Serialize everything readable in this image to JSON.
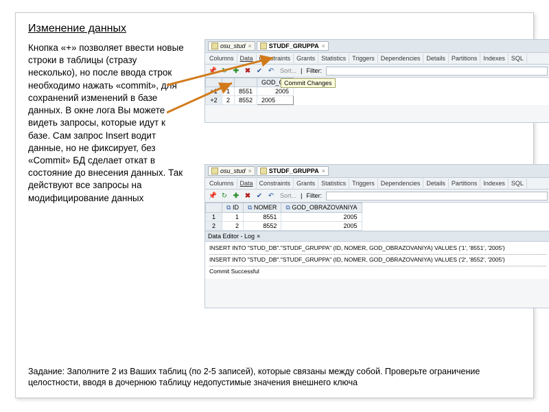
{
  "title": "Изменение данных",
  "body": "Кнопка «+» позволяет ввести новые строки в таблицы (стразу несколько), но после ввода строк необходимо нажать «commit», для сохранений изменений в базе данных. В окне лога Вы можете видеть запросы, которые идут к базе. Сам запрос Insert водит данные, но не фиксирует, без «Commit» БД сделает откат в состояние до  внесения данных. Так действуют все запросы на модифицирование данных",
  "task": "Задание: Заполните 2 из Ваших таблиц (по 2-5 записей), которые связаны между собой. Проверьте ограничение целостности, вводя в дочернюю таблицу недопустимые значения  внешнего ключа",
  "top_panel": {
    "file_tabs": [
      "osu_stud",
      "STUDF_GRUPPA"
    ],
    "sub_tabs": [
      "Columns",
      "Data",
      "Constraints",
      "Grants",
      "Statistics",
      "Triggers",
      "Dependencies",
      "Details",
      "Partitions",
      "Indexes",
      "SQL"
    ],
    "active_sub": "Data",
    "toolbar": {
      "sort": "Sort...",
      "filter": "Filter:"
    },
    "tooltip": "Commit Changes",
    "col_header_trunc": "GOD_O...",
    "rows": [
      {
        "n": "+1",
        "id": "1",
        "nomer": "8551",
        "god": "2005"
      },
      {
        "n": "+2",
        "id": "2",
        "nomer": "8552",
        "god": ""
      }
    ],
    "edit_cell": "2005"
  },
  "bottom_panel": {
    "file_tabs": [
      "osu_stud",
      "STUDF_GRUPPA"
    ],
    "sub_tabs": [
      "Columns",
      "Data",
      "Constraints",
      "Grants",
      "Statistics",
      "Triggers",
      "Dependencies",
      "Details",
      "Partitions",
      "Indexes",
      "SQL"
    ],
    "active_sub": "Data",
    "toolbar": {
      "sort": "Sort...",
      "filter": "Filter:"
    },
    "columns": [
      "ID",
      "NOMER",
      "GOD_OBRAZOVANIYA"
    ],
    "rows": [
      {
        "n": "1",
        "id": "1",
        "nomer": "8551",
        "god": "2005"
      },
      {
        "n": "2",
        "id": "2",
        "nomer": "8552",
        "god": "2005"
      }
    ],
    "log": {
      "title": "Data Editor - Log",
      "lines": [
        "INSERT INTO \"STUD_DB\".\"STUDF_GRUPPA\" (ID, NOMER, GOD_OBRAZOVANIYA) VALUES ('1', '8551', '2005')",
        "INSERT INTO \"STUD_DB\".\"STUDF_GRUPPA\" (ID, NOMER, GOD_OBRAZOVANIYA) VALUES ('2', '8552', '2005')"
      ],
      "status": "Commit Successful"
    }
  }
}
